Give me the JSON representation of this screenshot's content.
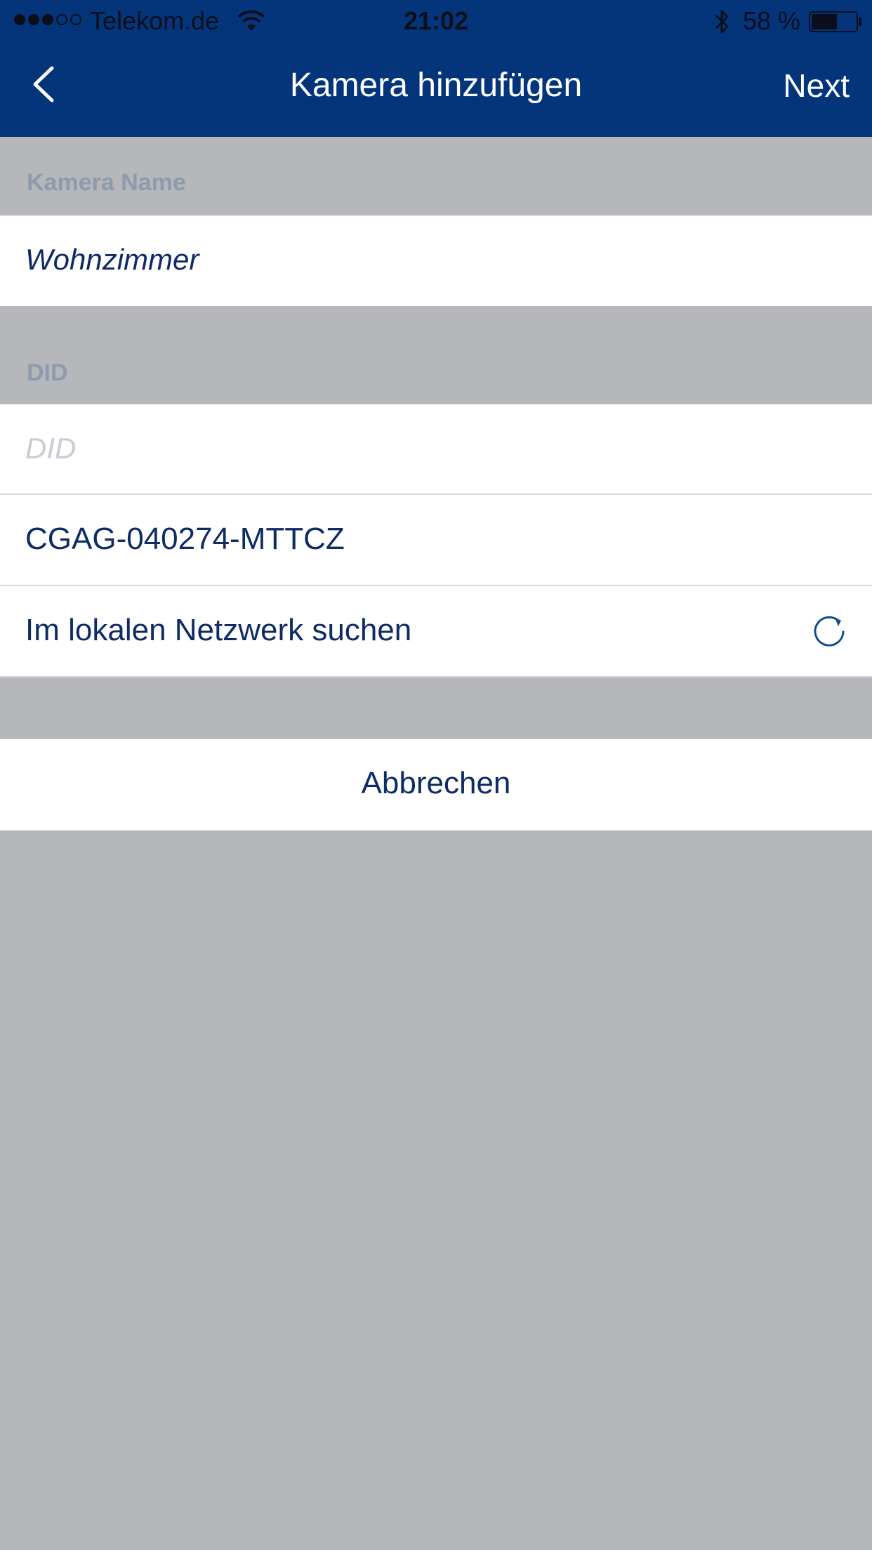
{
  "status_bar": {
    "carrier": "Telekom.de",
    "time": "21:02",
    "battery_percent": "58 %",
    "signal_bars_filled": 3,
    "signal_bars_total": 5,
    "battery_level": 0.58,
    "icons": [
      "wifi-icon",
      "bluetooth-icon",
      "battery-icon"
    ]
  },
  "nav": {
    "title": "Kamera hinzufügen",
    "next_label": "Next",
    "back_icon": "chevron-left-icon"
  },
  "form": {
    "camera_name_header": "Kamera Name",
    "camera_name_value": "Wohnzimmer",
    "did_header": "DID",
    "did_placeholder": "DID",
    "did_value": "",
    "suggested_did": "CGAG-040274-MTTCZ",
    "search_local_label": "Im lokalen Netzwerk suchen",
    "search_icon": "refresh-icon"
  },
  "actions": {
    "cancel_label": "Abbrechen"
  },
  "colors": {
    "nav_background": "#04357a",
    "page_background": "#b6b7bb",
    "text_primary": "#0f2b66",
    "section_label": "#8e9bad",
    "placeholder": "#c8ccd3"
  }
}
